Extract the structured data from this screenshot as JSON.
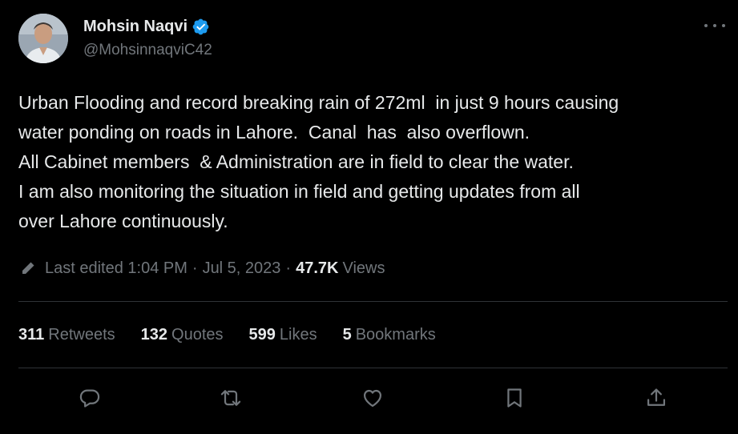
{
  "author": {
    "display_name": "Mohsin Naqvi",
    "handle": "@MohsinnaqviC42",
    "verified": true
  },
  "tweet": {
    "lines": [
      "Urban Flooding and record breaking rain of 272ml  in just 9 hours causing",
      "water ponding on roads in Lahore.  Canal  has  also overflown.",
      "All Cabinet members  & Administration are in field to clear the water.",
      "I am also monitoring the situation in field and getting updates from all",
      "over Lahore continuously."
    ]
  },
  "meta": {
    "edited_text": "Last edited 1:04 PM",
    "separator": "·",
    "date": "Jul 5, 2023",
    "views_count": "47.7K",
    "views_label": "Views"
  },
  "stats": {
    "retweets": {
      "count": "311",
      "label": "Retweets"
    },
    "quotes": {
      "count": "132",
      "label": "Quotes"
    },
    "likes": {
      "count": "599",
      "label": "Likes"
    },
    "bookmarks": {
      "count": "5",
      "label": "Bookmarks"
    }
  },
  "colors": {
    "background": "#000000",
    "text_primary": "#e7e9ea",
    "text_secondary": "#71767b",
    "divider": "#2f3336",
    "verified_badge": "#1d9bf0"
  },
  "icons": {
    "more": "more-horizontal-icon",
    "verified": "verified-badge-icon",
    "edit": "pencil-icon",
    "reply": "reply-icon",
    "retweet": "retweet-icon",
    "like": "heart-icon",
    "bookmark": "bookmark-icon",
    "share": "share-icon"
  }
}
